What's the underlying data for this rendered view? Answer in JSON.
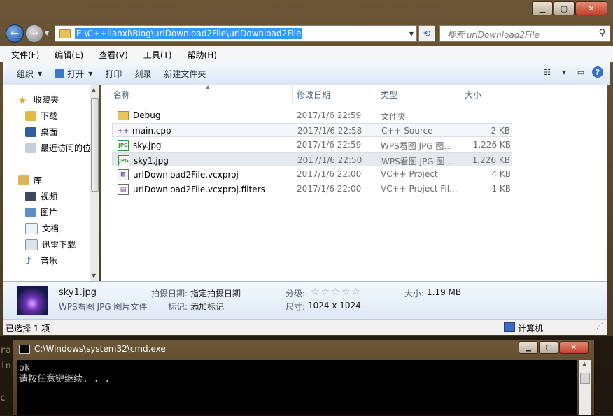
{
  "explorer": {
    "address": "E:\\C++lianxi\\Blog\\urlDownload2File\\urlDownload2File",
    "search_placeholder": "搜索 urlDownload2File",
    "menu": [
      "文件(F)",
      "编辑(E)",
      "查看(V)",
      "工具(T)",
      "帮助(H)"
    ],
    "toolbar": {
      "organize": "组织",
      "open": "打开",
      "print": "打印",
      "burn": "刻录",
      "new_folder": "新建文件夹"
    },
    "nav": {
      "favorites": "收藏夹",
      "downloads": "下载",
      "desktop": "桌面",
      "recent": "最近访问的位",
      "libraries": "库",
      "videos": "视频",
      "pictures": "图片",
      "documents": "文档",
      "thunder": "迅雷下载",
      "music": "音乐"
    },
    "columns": {
      "name": "名称",
      "date": "修改日期",
      "type": "类型",
      "size": "大小"
    },
    "files": [
      {
        "name": "Debug",
        "date": "2017/1/6 22:59",
        "type": "文件夹",
        "size": "",
        "icon": "folder-icon"
      },
      {
        "name": "main.cpp",
        "date": "2017/1/6 22:58",
        "type": "C++ Source",
        "size": "2 KB",
        "icon": "cpp-file-icon"
      },
      {
        "name": "sky.jpg",
        "date": "2017/1/6 22:59",
        "type": "WPS看图 JPG 图...",
        "size": "1,226 KB",
        "icon": "jpg-file-icon"
      },
      {
        "name": "sky1.jpg",
        "date": "2017/1/6 22:50",
        "type": "WPS看图 JPG 图...",
        "size": "1,226 KB",
        "icon": "jpg-file-icon"
      },
      {
        "name": "urlDownload2File.vcxproj",
        "date": "2017/1/6 22:00",
        "type": "VC++ Project",
        "size": "4 KB",
        "icon": "vcxproj-file-icon"
      },
      {
        "name": "urlDownload2File.vcxproj.filters",
        "date": "2017/1/6 22:00",
        "type": "VC++ Project Fil...",
        "size": "1 KB",
        "icon": "filters-file-icon"
      }
    ],
    "details": {
      "filename": "sky1.jpg",
      "filetype": "WPS看图 JPG 图片文件",
      "date_taken_label": "拍摄日期:",
      "date_taken_value": "指定拍摄日期",
      "tags_label": "标记:",
      "tags_value": "添加标记",
      "rating_label": "分级:",
      "rating_stars": 0,
      "size_label": "大小:",
      "size_value": "1.19 MB",
      "dims_label": "尺寸:",
      "dims_value": "1024 x 1024"
    },
    "status": {
      "selected": "已选择 1 项",
      "location": "计算机"
    }
  },
  "cmd": {
    "title": "C:\\Windows\\system32\\cmd.exe",
    "lines": [
      "ok",
      "请按任意键继续. . ."
    ]
  },
  "background": {
    "fragments": [
      "ra",
      "in",
      "c"
    ]
  }
}
